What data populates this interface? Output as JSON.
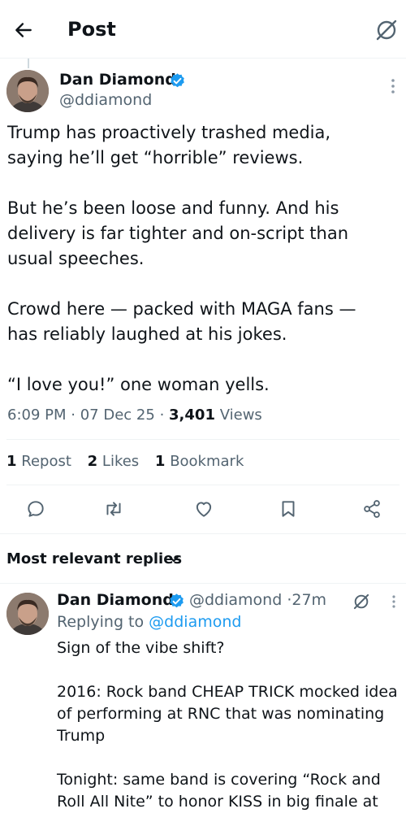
{
  "header": {
    "title": "Post"
  },
  "post": {
    "author_name": "Dan Diamond",
    "handle": "@ddiamond",
    "paragraphs": [
      "Trump has proactively trashed media,\nsaying he’ll get “horrible” reviews.",
      "But he’s been loose and funny. And his\ndelivery is far tighter and on-script than\nusual speeches.",
      "Crowd here — packed with MAGA fans —\nhas reliably laughed at his jokes.",
      "“I love you!” one woman yells."
    ],
    "time": "6:09 PM",
    "date": "07 Dec 25",
    "views_count": "3,401",
    "views_label": "Views",
    "sep": "·",
    "stats": {
      "reposts_count": "1",
      "reposts_label": "Repost",
      "likes_count": "2",
      "likes_label": "Likes",
      "bookmarks_count": "1",
      "bookmarks_label": "Bookmark"
    }
  },
  "actions": [
    "reply-icon",
    "repost-icon",
    "like-icon",
    "bookmark-icon",
    "share-icon"
  ],
  "replies_section": {
    "label": "Most relevant replies"
  },
  "reply": {
    "author_name": "Dan Diamond",
    "handle": "@ddiamond",
    "sep": "·",
    "time": "27m",
    "replying_prefix": "Replying to",
    "replying_handle": "@ddiamond",
    "paragraphs": [
      "Sign of the vibe shift?",
      "2016: Rock band CHEAP TRICK mocked idea of performing at RNC that was nominating Trump",
      "Tonight: same band is covering  “Rock and Roll All Nite” to honor KISS in big finale at"
    ]
  },
  "colors": {
    "accent": "#1d9bf0",
    "text_secondary": "#536471",
    "divider": "#eff3f4"
  }
}
